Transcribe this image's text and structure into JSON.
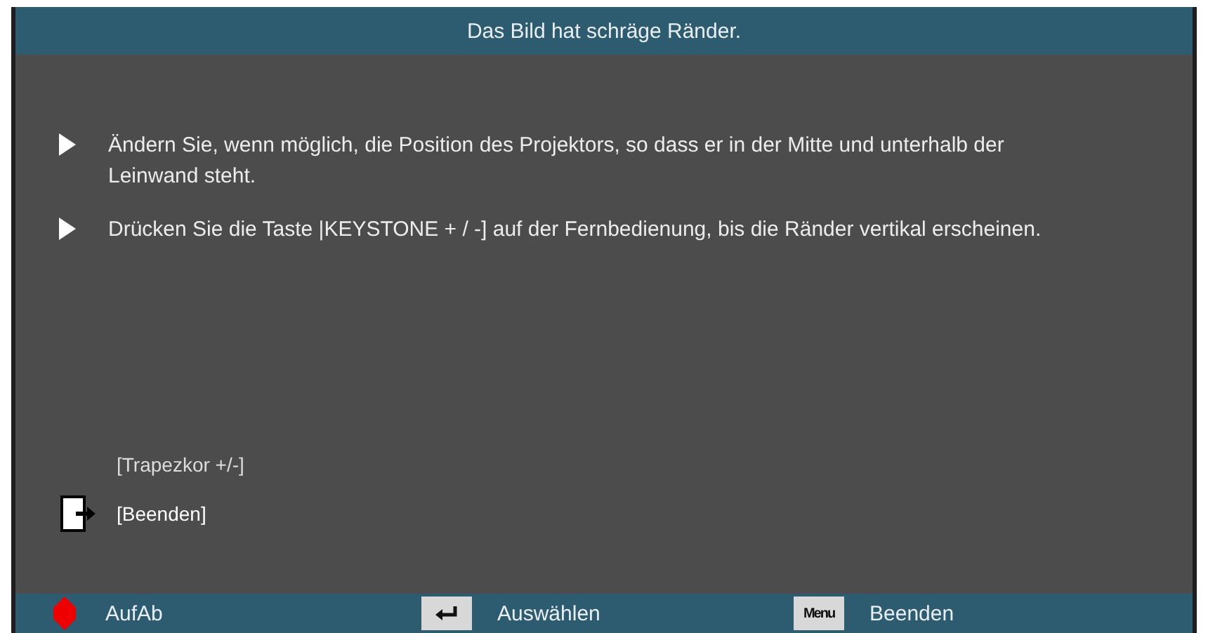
{
  "title": "Das Bild hat schräge Ränder.",
  "tips": [
    "Ändern Sie, wenn möglich, die Position des Projektors, so dass er in der Mitte und unterhalb der Leinwand steht.",
    "Drücken Sie die Taste |KEYSTONE + / -] auf der Fernbedienung, bis die Ränder vertikal erscheinen."
  ],
  "options": [
    {
      "label": "[Trapezkor +/-]",
      "selected": false
    },
    {
      "label": "[Beenden]",
      "selected": true
    }
  ],
  "footer": [
    {
      "kind": "updown",
      "label": "AufAb"
    },
    {
      "kind": "enter",
      "label": "Auswählen"
    },
    {
      "kind": "menu",
      "key": "Menu",
      "label": "Beenden"
    }
  ]
}
